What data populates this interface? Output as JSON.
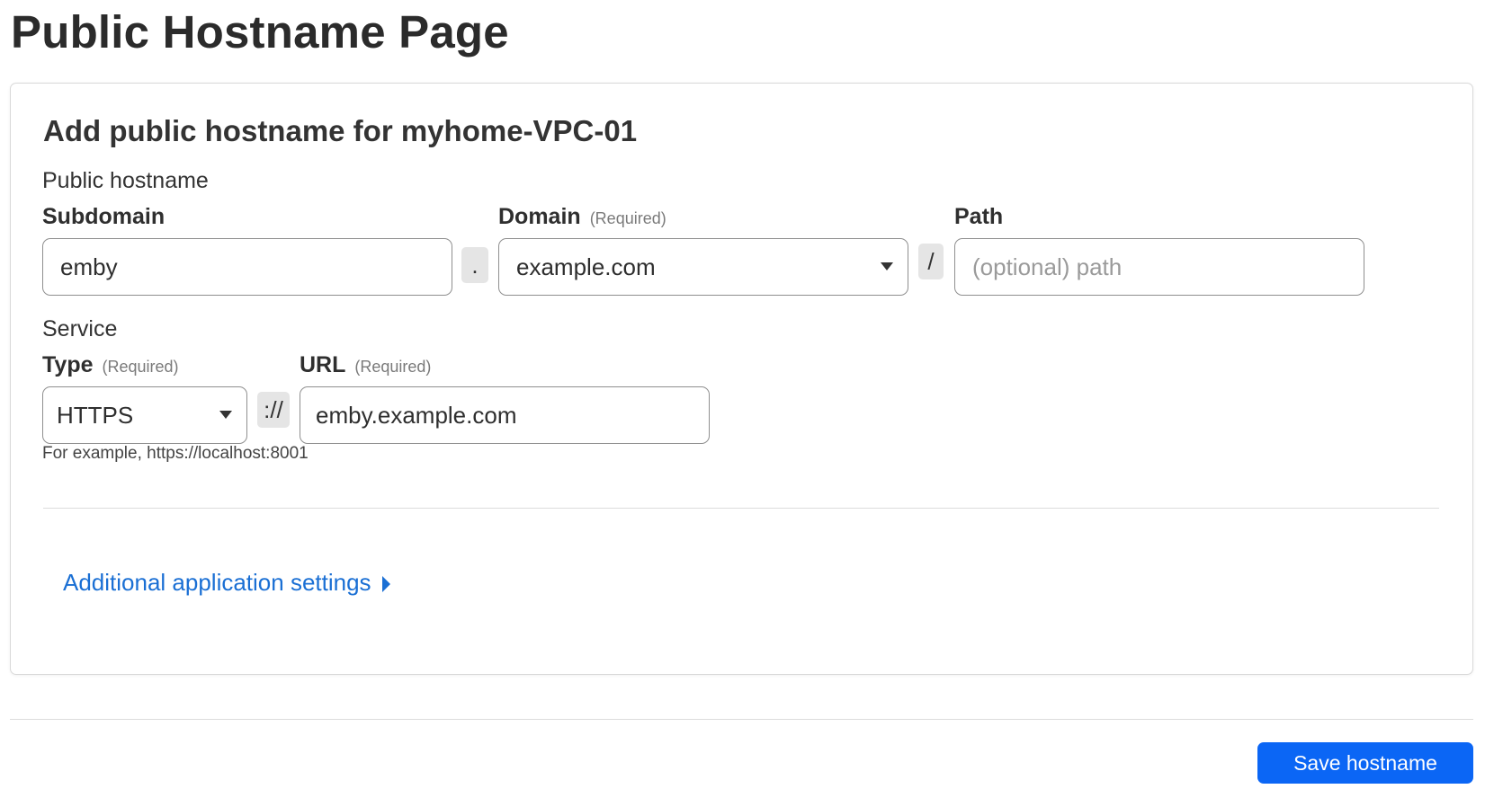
{
  "page": {
    "title": "Public Hostname Page"
  },
  "card": {
    "title": "Add public hostname for myhome-VPC-01",
    "public_hostname": {
      "section_label": "Public hostname",
      "subdomain": {
        "label": "Subdomain",
        "value": "emby"
      },
      "dot_separator": ".",
      "domain": {
        "label": "Domain",
        "required": "(Required)",
        "selected": "example.com"
      },
      "slash_separator": "/",
      "path": {
        "label": "Path",
        "placeholder": "(optional) path",
        "value": ""
      }
    },
    "service": {
      "section_label": "Service",
      "type": {
        "label": "Type",
        "required": "(Required)",
        "selected": "HTTPS"
      },
      "scheme_separator": "://",
      "url": {
        "label": "URL",
        "required": "(Required)",
        "value": "emby.example.com"
      },
      "help_text": "For example, https://localhost:8001"
    },
    "additional_settings_link": "Additional application settings"
  },
  "footer": {
    "save_button": "Save hostname"
  },
  "colors": {
    "primary": "#0b66f5",
    "link": "#1a6fd4",
    "border": "#8f8f8f",
    "separator_bg": "#e5e5e5"
  },
  "icons": {
    "domain_dropdown": "caret-down-icon",
    "type_dropdown": "caret-down-icon",
    "additional_settings": "caret-right-icon"
  }
}
